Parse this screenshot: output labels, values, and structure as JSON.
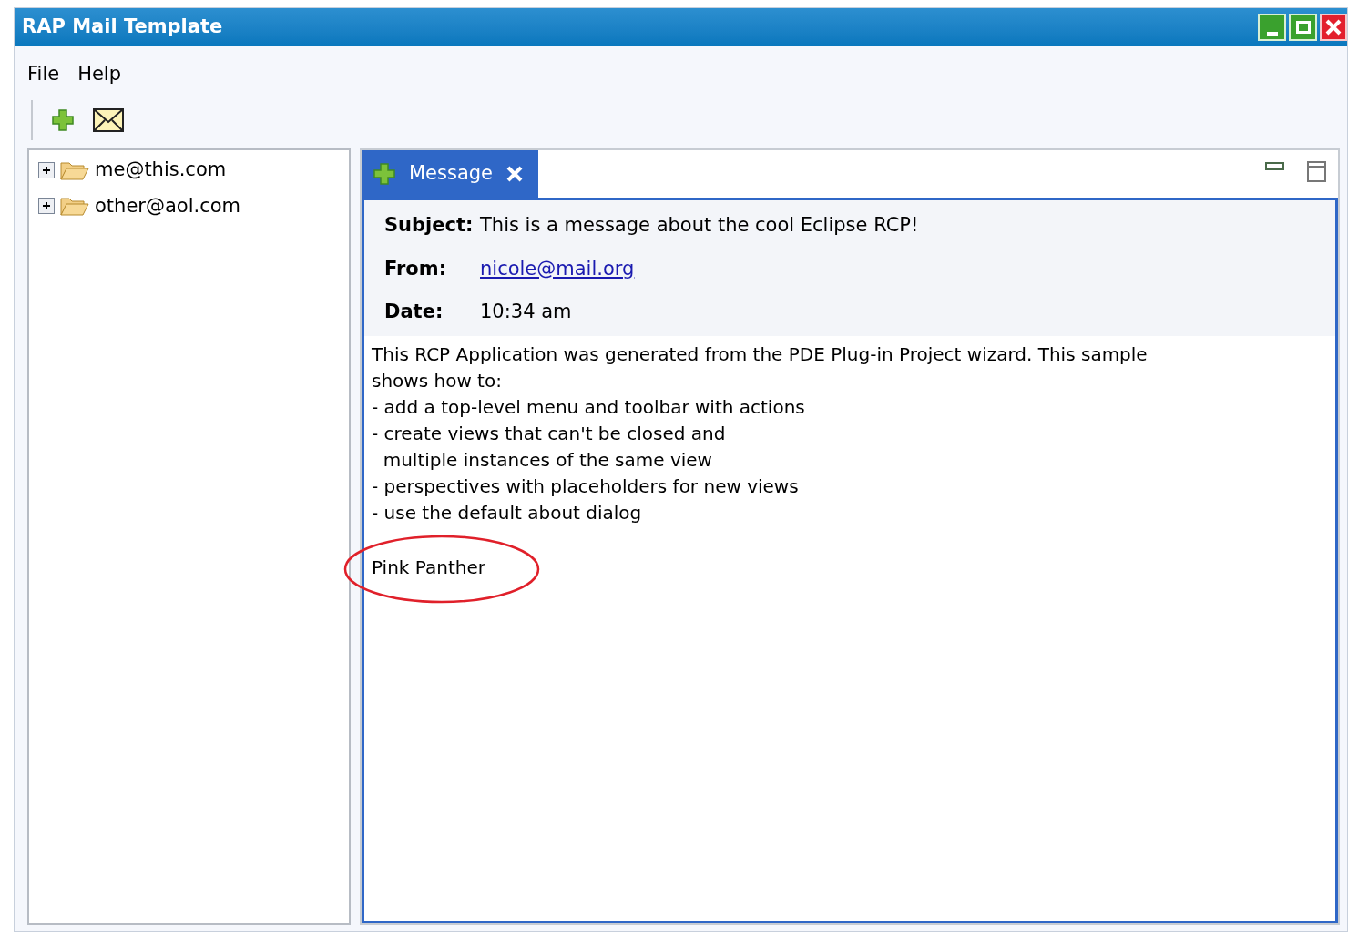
{
  "window": {
    "title": "RAP Mail Template"
  },
  "menu": [
    "File",
    "Help"
  ],
  "tree": [
    {
      "label": "me@this.com",
      "expanded": false
    },
    {
      "label": "other@aol.com",
      "expanded": false
    }
  ],
  "tabs": [
    {
      "label": "Message",
      "selected": true
    }
  ],
  "message": {
    "fields": [
      {
        "label": "Subject:",
        "value": "This is a message about the cool Eclipse RCP!",
        "kind": "text"
      },
      {
        "label": "From:",
        "value": "nicole@mail.org",
        "kind": "link"
      },
      {
        "label": "Date:",
        "value": "10:34 am",
        "kind": "text"
      }
    ],
    "body_lines": [
      "This RCP Application was generated from the PDE Plug-in Project wizard. This sample",
      "shows how to:",
      "- add a top-level menu and toolbar with actions",
      "- create views that can't be closed and",
      "  multiple instances of the same view",
      "- perspectives with placeholders for new views",
      "- use the default about dialog"
    ],
    "signature": "Pink Panther"
  }
}
